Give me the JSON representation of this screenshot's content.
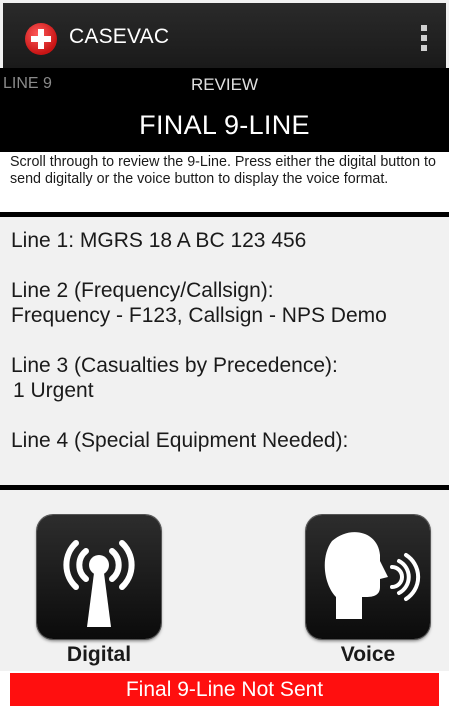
{
  "app": {
    "title": "CASEVAC",
    "icon": "red-cross-icon",
    "menu_icon": "overflow-menu-icon"
  },
  "tabs": {
    "previous": "LINE 9",
    "current": "REVIEW"
  },
  "page_title": "FINAL 9-LINE",
  "instructions": "Scroll through to review the 9-Line. Press either the digital button to send digitally or the voice button to display the voice format.",
  "review": {
    "lines": [
      {
        "label": "Line 1: MGRS 18 A BC 123 456",
        "value": ""
      },
      {
        "label": "Line 2 (Frequency/Callsign):",
        "value": "Frequency - F123, Callsign - NPS Demo"
      },
      {
        "label": "Line 3 (Casualties by Precedence):",
        "value": "1 Urgent"
      },
      {
        "label": "Line 4 (Special Equipment Needed):",
        "value": ""
      }
    ]
  },
  "buttons": {
    "digital": {
      "label": "Digital",
      "icon": "radio-antenna-icon"
    },
    "voice": {
      "label": "Voice",
      "icon": "speaking-head-icon"
    }
  },
  "status": {
    "text": "Final 9-Line Not Sent",
    "color": "#ff0f0f"
  }
}
